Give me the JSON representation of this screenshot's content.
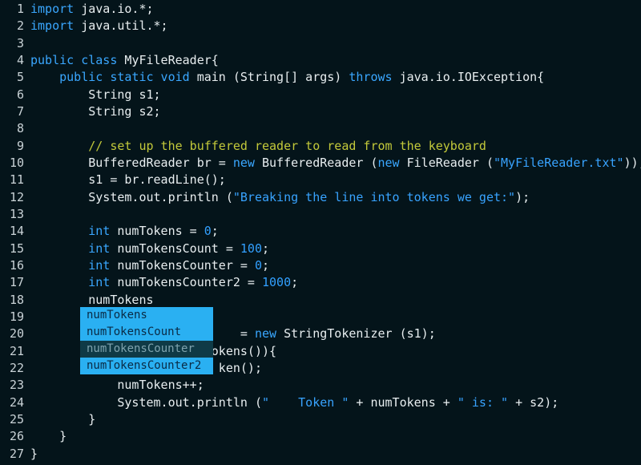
{
  "editor": {
    "lines": [
      {
        "n": "1",
        "tokens": [
          {
            "t": "kw",
            "s": "import"
          },
          {
            "t": "plain",
            "s": " java.io.*;"
          }
        ]
      },
      {
        "n": "2",
        "tokens": [
          {
            "t": "kw",
            "s": "import"
          },
          {
            "t": "plain",
            "s": " java.util.*;"
          }
        ]
      },
      {
        "n": "3",
        "tokens": []
      },
      {
        "n": "4",
        "tokens": [
          {
            "t": "kw",
            "s": "public class"
          },
          {
            "t": "plain",
            "s": " MyFileReader{"
          }
        ]
      },
      {
        "n": "5",
        "tokens": [
          {
            "t": "plain",
            "s": "    "
          },
          {
            "t": "kw",
            "s": "public static void"
          },
          {
            "t": "plain",
            "s": " main (String[] args) "
          },
          {
            "t": "kw",
            "s": "throws"
          },
          {
            "t": "plain",
            "s": " java.io.IOException{"
          }
        ]
      },
      {
        "n": "6",
        "tokens": [
          {
            "t": "plain",
            "s": "        String s1;"
          }
        ]
      },
      {
        "n": "7",
        "tokens": [
          {
            "t": "plain",
            "s": "        String s2;"
          }
        ]
      },
      {
        "n": "8",
        "tokens": []
      },
      {
        "n": "9",
        "tokens": [
          {
            "t": "plain",
            "s": "        "
          },
          {
            "t": "cm",
            "s": "// set up the buffered reader to read from the keyboard"
          }
        ]
      },
      {
        "n": "10",
        "tokens": [
          {
            "t": "plain",
            "s": "        BufferedReader br = "
          },
          {
            "t": "kw",
            "s": "new"
          },
          {
            "t": "plain",
            "s": " BufferedReader ("
          },
          {
            "t": "kw",
            "s": "new"
          },
          {
            "t": "plain",
            "s": " FileReader ("
          },
          {
            "t": "str",
            "s": "\"MyFileReader.txt\""
          },
          {
            "t": "plain",
            "s": "));"
          }
        ]
      },
      {
        "n": "11",
        "tokens": [
          {
            "t": "plain",
            "s": "        s1 = br.readLine();"
          }
        ]
      },
      {
        "n": "12",
        "tokens": [
          {
            "t": "plain",
            "s": "        System.out.println ("
          },
          {
            "t": "str",
            "s": "\"Breaking the line into tokens we get:\""
          },
          {
            "t": "plain",
            "s": ");"
          }
        ]
      },
      {
        "n": "13",
        "tokens": []
      },
      {
        "n": "14",
        "tokens": [
          {
            "t": "plain",
            "s": "        "
          },
          {
            "t": "kw",
            "s": "int"
          },
          {
            "t": "plain",
            "s": " numTokens = "
          },
          {
            "t": "num",
            "s": "0"
          },
          {
            "t": "plain",
            "s": ";"
          }
        ]
      },
      {
        "n": "15",
        "tokens": [
          {
            "t": "plain",
            "s": "        "
          },
          {
            "t": "kw",
            "s": "int"
          },
          {
            "t": "plain",
            "s": " numTokensCount = "
          },
          {
            "t": "num",
            "s": "100"
          },
          {
            "t": "plain",
            "s": ";"
          }
        ]
      },
      {
        "n": "16",
        "tokens": [
          {
            "t": "plain",
            "s": "        "
          },
          {
            "t": "kw",
            "s": "int"
          },
          {
            "t": "plain",
            "s": " numTokensCounter = "
          },
          {
            "t": "num",
            "s": "0"
          },
          {
            "t": "plain",
            "s": ";"
          }
        ]
      },
      {
        "n": "17",
        "tokens": [
          {
            "t": "plain",
            "s": "        "
          },
          {
            "t": "kw",
            "s": "int"
          },
          {
            "t": "plain",
            "s": " numTokensCounter2 = "
          },
          {
            "t": "num",
            "s": "1000"
          },
          {
            "t": "plain",
            "s": ";"
          }
        ]
      },
      {
        "n": "18",
        "tokens": [
          {
            "t": "plain",
            "s": "        numTokens"
          }
        ]
      },
      {
        "n": "19",
        "tokens": []
      },
      {
        "n": "20",
        "tokens": [
          {
            "t": "plain",
            "s": "                             = "
          },
          {
            "t": "kw",
            "s": "new"
          },
          {
            "t": "plain",
            "s": " StringTokenizer (s1);"
          }
        ]
      },
      {
        "n": "21",
        "tokens": [
          {
            "t": "plain",
            "s": "                         okens()){"
          }
        ]
      },
      {
        "n": "22",
        "tokens": [
          {
            "t": "plain",
            "s": "                          ken();"
          }
        ]
      },
      {
        "n": "23",
        "tokens": [
          {
            "t": "plain",
            "s": "            numTokens++;"
          }
        ]
      },
      {
        "n": "24",
        "tokens": [
          {
            "t": "plain",
            "s": "            System.out.println ("
          },
          {
            "t": "str",
            "s": "\"    Token \""
          },
          {
            "t": "plain",
            "s": " + numTokens + "
          },
          {
            "t": "str",
            "s": "\" is: \""
          },
          {
            "t": "plain",
            "s": " + s2);"
          }
        ]
      },
      {
        "n": "25",
        "tokens": [
          {
            "t": "plain",
            "s": "        }"
          }
        ]
      },
      {
        "n": "26",
        "tokens": [
          {
            "t": "plain",
            "s": "    }"
          }
        ]
      },
      {
        "n": "27",
        "tokens": [
          {
            "t": "plain",
            "s": "}"
          }
        ]
      }
    ],
    "autocomplete": {
      "items": [
        {
          "label": "numTokens",
          "state": "normal"
        },
        {
          "label": "numTokensCount",
          "state": "normal"
        },
        {
          "label": "numTokensCounter",
          "state": "dim"
        },
        {
          "label": "numTokensCounter2",
          "state": "selected"
        }
      ]
    }
  },
  "colors": {
    "background": "#04141a",
    "keyword": "#3aa7ff",
    "comment": "#c3c93a",
    "autocomplete_highlight": "#2ab0f2"
  }
}
